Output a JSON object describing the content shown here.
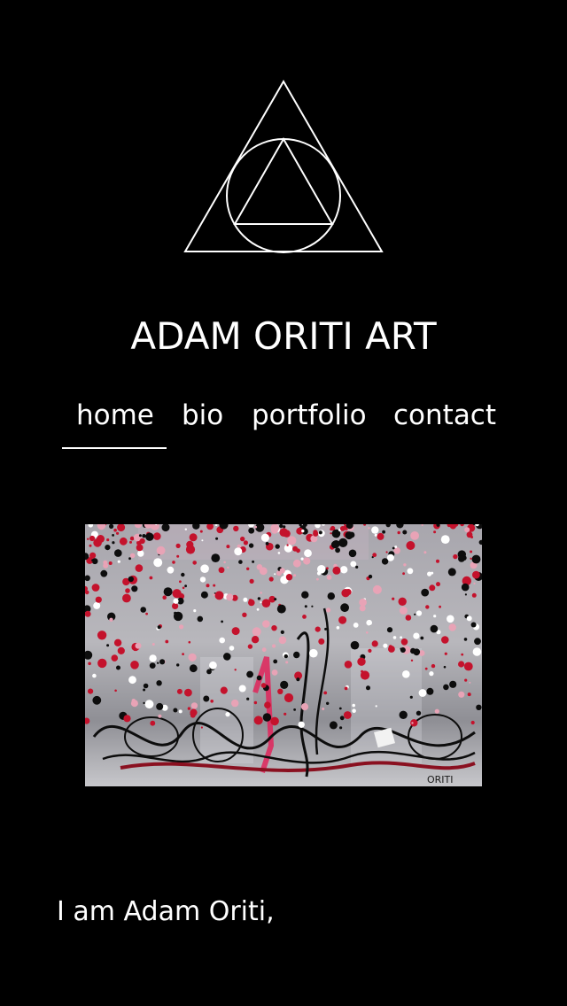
{
  "site": {
    "title": "ADAM ORITI ART"
  },
  "logo": {
    "icon": "triangle-circle-logo-icon"
  },
  "nav": {
    "items": [
      {
        "label": "home",
        "active": true
      },
      {
        "label": "bio",
        "active": false
      },
      {
        "label": "portfolio",
        "active": false
      },
      {
        "label": "contact",
        "active": false
      }
    ]
  },
  "artwork": {
    "signature": "ORITI",
    "colors": {
      "background": "#a9a9ad",
      "red": "#c4122c",
      "black": "#0d0d0d",
      "white": "#ffffff",
      "pink": "#e8a3b6"
    }
  },
  "intro": {
    "text": "I am Adam Oriti,"
  },
  "theme": {
    "background": "#000000",
    "text": "#ffffff"
  }
}
